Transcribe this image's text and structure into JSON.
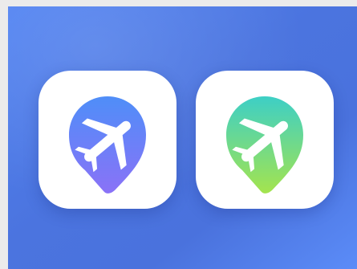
{
  "scene": {
    "background_colors": [
      "#5183f2",
      "#4b74df",
      "#4a72dd",
      "#5b8cf8"
    ],
    "page_border_color": "#ebebeb"
  },
  "icons": [
    {
      "name": "blue-plane-pin-icon",
      "tile_color": "#ffffff",
      "gradient_top": "#4f8ef8",
      "gradient_bottom": "#8a72f7",
      "glyph_color": "#ffffff"
    },
    {
      "name": "green-plane-pin-icon",
      "tile_color": "#ffffff",
      "gradient_top": "#3dcfc6",
      "gradient_bottom": "#a4e44e",
      "glyph_color": "#ffffff"
    }
  ]
}
